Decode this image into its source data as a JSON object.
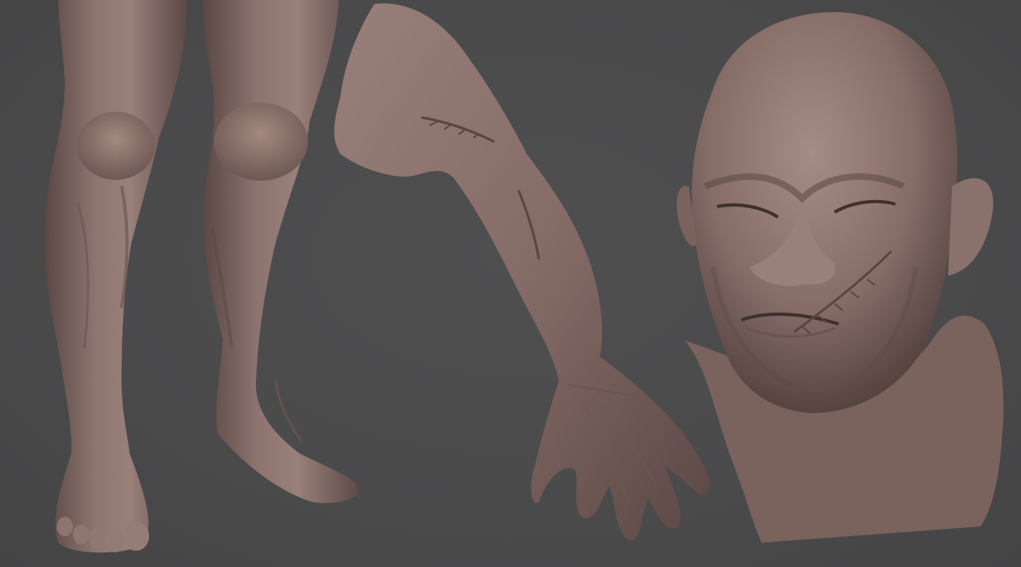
{
  "scene": {
    "background_color": "#4b4b4c",
    "clay_color": "#8a716c",
    "clay_highlight": "#a88f89",
    "clay_shadow": "#4e3d3a"
  },
  "models": [
    {
      "name": "legs",
      "icon": "legs-sculpt"
    },
    {
      "name": "arm",
      "icon": "arm-sculpt"
    },
    {
      "name": "head",
      "icon": "head-sculpt"
    }
  ]
}
